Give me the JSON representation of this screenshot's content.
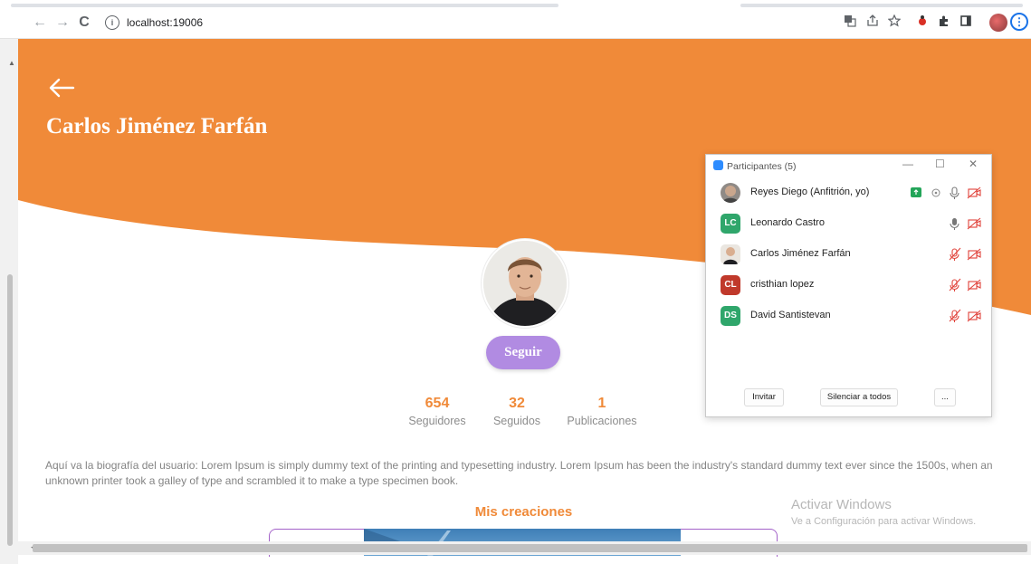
{
  "browser": {
    "url": "localhost:19006",
    "nav": {
      "back": "←",
      "forward": "→",
      "reload": "C"
    },
    "info_glyph": "i"
  },
  "page": {
    "profile_name": "Carlos Jiménez Farfán",
    "follow_label": "Seguir",
    "stats": [
      {
        "value": "654",
        "label": "Seguidores"
      },
      {
        "value": "32",
        "label": "Seguidos"
      },
      {
        "value": "1",
        "label": "Publicaciones"
      }
    ],
    "bio": "Aquí va la biografía del usuario: Lorem Ipsum is simply dummy text of the printing and typesetting industry. Lorem Ipsum has been the industry's standard dummy text ever since the 1500s, when an unknown printer took a galley of type and scrambled it to make a type specimen book.",
    "section_title": "Mis creaciones",
    "colors": {
      "header": "#f08a39",
      "accent": "#f08a39",
      "follow_button": "#b18be2"
    }
  },
  "zoom_panel": {
    "title": "Participantes (5)",
    "participants": [
      {
        "name": "Reyes Diego (Anfitrión, yo)",
        "initials": "",
        "avatar_color": "#7a6a5a",
        "mic": "on",
        "video": "off"
      },
      {
        "name": "Leonardo Castro",
        "initials": "LC",
        "avatar_color": "#2fa66b",
        "mic": "on",
        "video": "off"
      },
      {
        "name": "Carlos Jiménez Farfán",
        "initials": "",
        "avatar_color": "#d8cfc4",
        "mic": "muted",
        "video": "off"
      },
      {
        "name": "cristhian lopez",
        "initials": "CL",
        "avatar_color": "#c0392b",
        "mic": "muted",
        "video": "off"
      },
      {
        "name": "David Santistevan",
        "initials": "DS",
        "avatar_color": "#2fa66b",
        "mic": "muted",
        "video": "off"
      }
    ],
    "buttons": {
      "invite": "Invitar",
      "mute_all": "Silenciar a todos",
      "more": "..."
    }
  },
  "watermark": {
    "title": "Activar Windows",
    "subtitle": "Ve a Configuración para activar Windows."
  }
}
